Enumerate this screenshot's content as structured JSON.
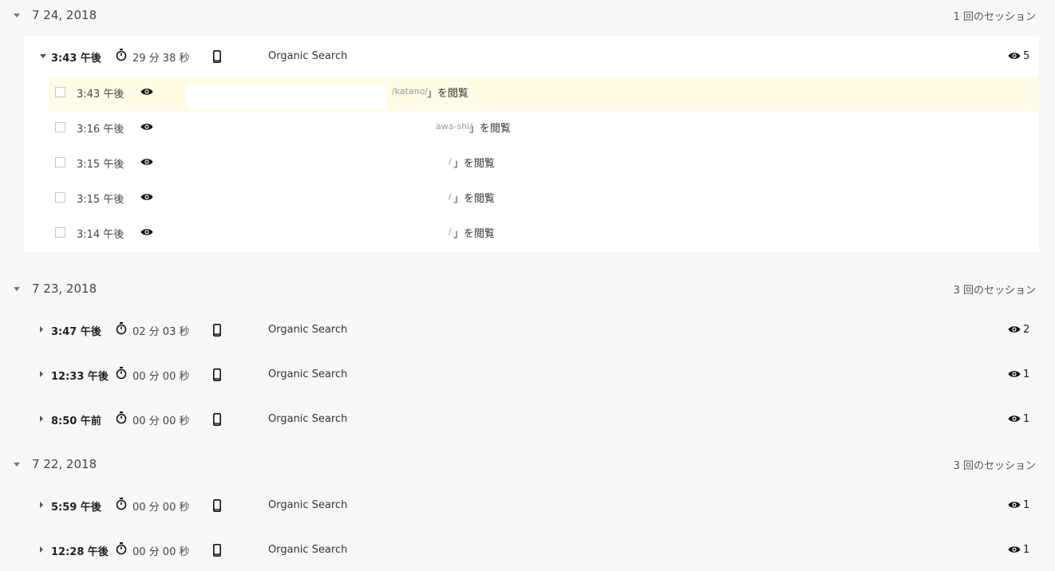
{
  "groups": [
    {
      "date": "7 24, 2018",
      "session_count": "1 回のセッション",
      "sessions": [
        {
          "time": "3:43 午後",
          "duration": "29 分 38 秒",
          "source": "Organic Search",
          "views": "5",
          "expanded": true,
          "hits": [
            {
              "time": "3:43 午後",
              "path": "/katano/",
              "suffix": "」を閲覧"
            },
            {
              "time": "3:16 午後",
              "path": "awa-shi/",
              "suffix": "」を閲覧"
            },
            {
              "time": "3:15 午後",
              "path": "/",
              "suffix": "」を閲覧"
            },
            {
              "time": "3:15 午後",
              "path": "/",
              "suffix": "」を閲覧"
            },
            {
              "time": "3:14 午後",
              "path": "/",
              "suffix": "」を閲覧"
            }
          ]
        }
      ]
    },
    {
      "date": "7 23, 2018",
      "session_count": "3 回のセッション",
      "sessions": [
        {
          "time": "3:47 午後",
          "duration": "02 分 03 秒",
          "source": "Organic Search",
          "views": "2"
        },
        {
          "time": "12:33 午後",
          "duration": "00 分 00 秒",
          "source": "Organic Search",
          "views": "1"
        },
        {
          "time": "8:50 午前",
          "duration": "00 分 00 秒",
          "source": "Organic Search",
          "views": "1"
        }
      ]
    },
    {
      "date": "7 22, 2018",
      "session_count": "3 回のセッション",
      "sessions": [
        {
          "time": "5:59 午後",
          "duration": "00 分 00 秒",
          "source": "Organic Search",
          "views": "1"
        },
        {
          "time": "12:28 午後",
          "duration": "00 分 00 秒",
          "source": "Organic Search",
          "views": "1"
        }
      ]
    }
  ],
  "colors": {
    "background": "#f7f7f7",
    "card": "#ffffff",
    "highlight": "#fffbe5",
    "icon": "#111111"
  },
  "icons": {
    "expand": "chevron-down-icon",
    "collapse": "chevron-right-icon",
    "duration": "stopwatch-icon",
    "device": "smartphone-icon",
    "views": "eye-icon"
  }
}
